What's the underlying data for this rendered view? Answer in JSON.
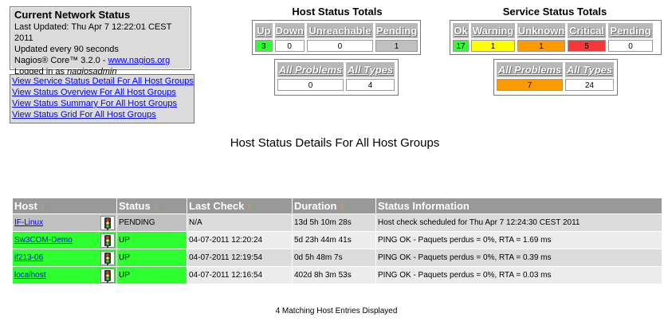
{
  "info": {
    "title": "Current Network Status",
    "updated": "Last Updated: Thu Apr 7 12:22:01 CEST 2011",
    "interval": "Updated every 90 seconds",
    "version_prefix": "Nagios® Core™ 3.2.0 - ",
    "version_link": "www.nagios.org",
    "login_prefix": "Logged in as ",
    "login_user": "nagiosadmin"
  },
  "links": [
    "View Service Status Detail For All Host Groups",
    "View Status Overview For All Host Groups",
    "View Status Summary For All Host Groups",
    "View Status Grid For All Host Groups"
  ],
  "host_totals": {
    "title": "Host Status Totals",
    "headers": [
      "Up",
      "Down",
      "Unreachable",
      "Pending"
    ],
    "values": [
      "3",
      "0",
      "0",
      "1"
    ],
    "problems_headers": [
      "All Problems",
      "All Types"
    ],
    "problems_values": [
      "0",
      "4"
    ]
  },
  "service_totals": {
    "title": "Service Status Totals",
    "headers": [
      "Ok",
      "Warning",
      "Unknown",
      "Critical",
      "Pending"
    ],
    "values": [
      "17",
      "1",
      "1",
      "5",
      "0"
    ],
    "problems_headers": [
      "All Problems",
      "All Types"
    ],
    "problems_values": [
      "7",
      "24"
    ]
  },
  "page_title": "Host Status Details For All Host Groups",
  "table": {
    "headers": [
      "Host",
      "Status",
      "Last Check",
      "Duration",
      "Status Information"
    ],
    "sort_arrows": "↑↓",
    "rows": [
      {
        "host": "IF-Linux",
        "status": "PENDING",
        "last_check": "N/A",
        "duration": "13d 5h 10m 28s",
        "info": "Host check scheduled for Thu Apr 7 12:24:30 CEST 2011"
      },
      {
        "host": "Sw3COM-Demo",
        "status": "UP",
        "last_check": "04-07-2011 12:20:24",
        "duration": "5d 23h 44m 41s",
        "info": "PING OK - Paquets perdus = 0%, RTA = 1.69 ms"
      },
      {
        "host": "if213-06",
        "status": "UP",
        "last_check": "04-07-2011 12:19:54",
        "duration": "0d 5h 48m 7s",
        "info": "PING OK - Paquets perdus = 0%, RTA = 0.39 ms"
      },
      {
        "host": "localhost",
        "status": "UP",
        "last_check": "04-07-2011 12:16:54",
        "duration": "402d 8h 3m 53s",
        "info": "PING OK - Paquets perdus = 0%, RTA = 0.03 ms"
      }
    ]
  },
  "footer": "4 Matching Host Entries Displayed",
  "colors": {
    "up": "#2eff2e",
    "warning": "#ffff00",
    "unknown": "#ff9900",
    "critical": "#f83838",
    "pending": "#c0c0c0"
  }
}
